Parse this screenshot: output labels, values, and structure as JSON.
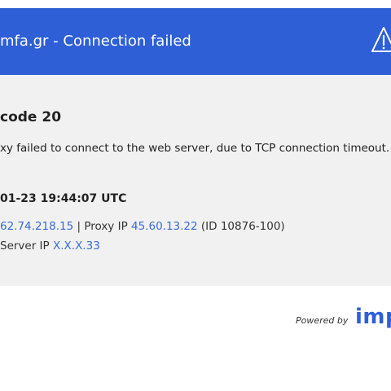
{
  "header": {
    "title": "mfa.gr - Connection failed",
    "bg_color": "#2e5fd6",
    "icon": "warning-icon"
  },
  "error": {
    "code": "code 20",
    "description": "xy failed to connect to the web server, due to TCP connection timeout."
  },
  "details": {
    "timestamp": "01-23 19:44:07 UTC",
    "client_ip_link": "62.74.218.15",
    "proxy_sep": " | Proxy IP ",
    "proxy_ip_link": "45.60.13.22",
    "proxy_id": " (ID 10876-100)",
    "server_label": "Server IP ",
    "server_ip_link": "X.X.X.33"
  },
  "footer": {
    "powered_by": "Powered by",
    "brand": "imp",
    "brand_color": "#2e5fd6"
  }
}
